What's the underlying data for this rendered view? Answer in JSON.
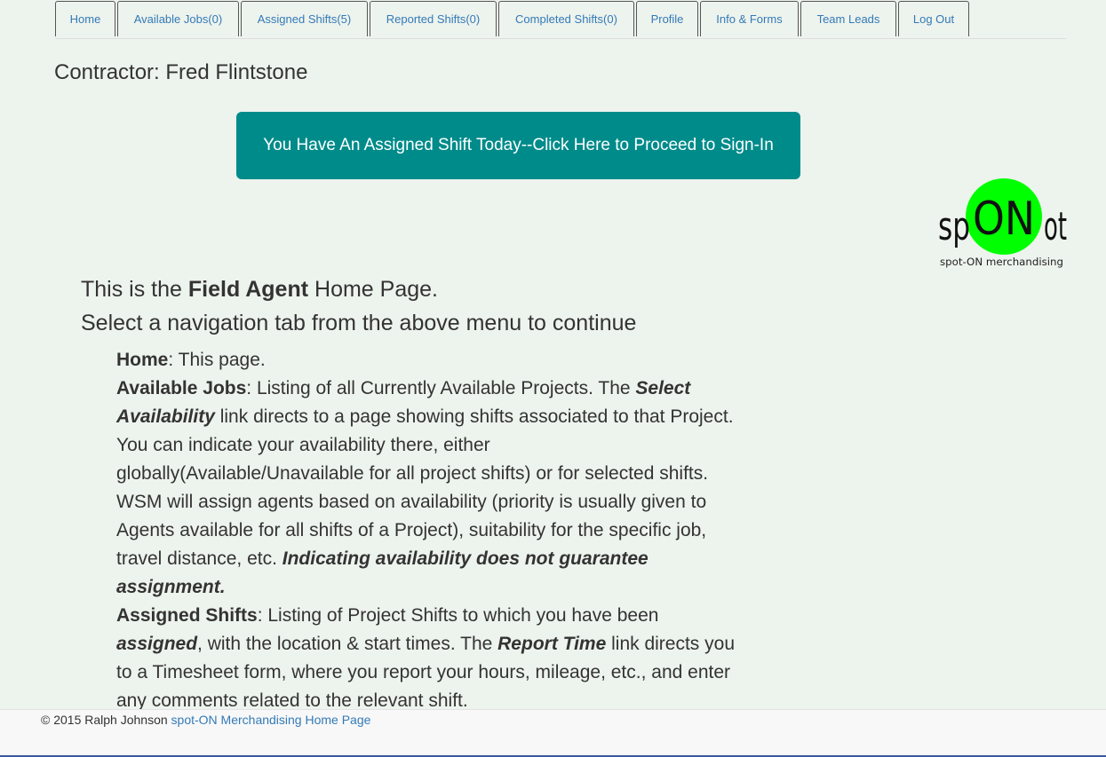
{
  "nav": {
    "tabs": [
      {
        "label": "Home"
      },
      {
        "label": "Available Jobs(0)"
      },
      {
        "label": "Assigned Shifts(5)"
      },
      {
        "label": "Reported Shifts(0)"
      },
      {
        "label": "Completed Shifts(0)"
      },
      {
        "label": "Profile"
      },
      {
        "label": "Info & Forms"
      },
      {
        "label": "Team Leads"
      },
      {
        "label": "Log Out"
      }
    ]
  },
  "contractor_text": "Contractor: Fred Flintstone",
  "signin_button": "You Have An Assigned Shift Today--Click Here to Proceed to Sign-In",
  "logo": {
    "part1": "sp",
    "part2": "ON",
    "part3": "ot",
    "tagline": "spot-ON merchandising",
    "circle_color": "#00ff00"
  },
  "main": {
    "line1_pre": "This is the ",
    "line1_bold": "Field Agent",
    "line1_post": " Home Page.",
    "line2": "Select a navigation tab from the above menu to continue"
  },
  "desc": {
    "home_term": "Home",
    "home_text": ": This page.",
    "avail_term": "Available Jobs",
    "avail_text1": ": Listing of all Currently Available Projects. The ",
    "avail_em": "Select Availability",
    "avail_text2": " link directs to a page showing shifts associated to that Project. You can indicate your availability there, either globally(Available/Unavailable for all project shifts) or for selected shifts. WSM will assign agents based on availability (priority is usually given to Agents available for all shifts of a Project), suitability for the specific job, travel distance, etc. ",
    "avail_em2": "Indicating availability does not guarantee assignment.",
    "assigned_term": "Assigned Shifts",
    "assigned_text1": ": Listing of Project Shifts to which you have been ",
    "assigned_em": "assigned",
    "assigned_text2": ", with the location & start times. The ",
    "assigned_em2": "Report Time",
    "assigned_text3": " link directs you to a Timesheet form, where you report your hours, mileage, etc., and enter any comments related to the relevant shift."
  },
  "footer": {
    "copyright": "© 2015 Ralph Johnson ",
    "link": "spot-ON Merchandising Home Page"
  }
}
